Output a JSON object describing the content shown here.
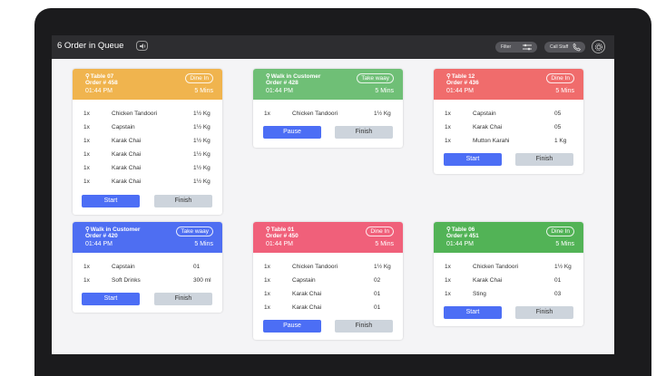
{
  "topbar": {
    "title": "6 Order in Queue",
    "filter_label": "Filter",
    "call_staff_label": "Call Staff"
  },
  "orders": [
    {
      "table": "Table 07",
      "order": "Order # 458",
      "time": "01:44 PM",
      "type": "Dine In",
      "duration": "5 Mins",
      "color": "#f0b44e",
      "items": [
        {
          "qty": "1x",
          "name": "Chicken Tandoori",
          "amount": "1½ Kg"
        },
        {
          "qty": "1x",
          "name": "Capstain",
          "amount": "1½ Kg"
        },
        {
          "qty": "1x",
          "name": "Karak Chai",
          "amount": "1½ Kg"
        },
        {
          "qty": "1x",
          "name": "Karak Chai",
          "amount": "1½ Kg"
        },
        {
          "qty": "1x",
          "name": "Karak Chai",
          "amount": "1½ Kg"
        },
        {
          "qty": "1x",
          "name": "Karak Chai",
          "amount": "1½ Kg"
        }
      ],
      "primary": "Start",
      "secondary": "Finish"
    },
    {
      "table": "Walk in Customer",
      "order": "Order # 428",
      "time": "01:44 PM",
      "type": "Take waay",
      "duration": "5 Mins",
      "color": "#6fbf76",
      "items": [
        {
          "qty": "1x",
          "name": "Chicken Tandoori",
          "amount": "1½ Kg"
        }
      ],
      "primary": "Pause",
      "secondary": "Finish"
    },
    {
      "table": "Table 12",
      "order": "Order # 436",
      "time": "01:44 PM",
      "type": "Dine In",
      "duration": "5 Mins",
      "color": "#f06c6c",
      "items": [
        {
          "qty": "1x",
          "name": "Capstain",
          "amount": "05"
        },
        {
          "qty": "1x",
          "name": "Karak Chai",
          "amount": "05"
        },
        {
          "qty": "1x",
          "name": "Mutton Karahi",
          "amount": "1 Kg"
        }
      ],
      "primary": "Start",
      "secondary": "Finish"
    },
    {
      "table": "Walk in Customer",
      "order": "Order # 420",
      "time": "01:44 PM",
      "type": "Take waay",
      "duration": "5 Mins",
      "color": "#4e6ef2",
      "items": [
        {
          "qty": "1x",
          "name": "Capstain",
          "amount": "01"
        },
        {
          "qty": "1x",
          "name": "Soft Drinks",
          "amount": "300 ml"
        }
      ],
      "primary": "Start",
      "secondary": "Finish"
    },
    {
      "table": "Table 01",
      "order": "Order # 450",
      "time": "01:44 PM",
      "type": "Dine In",
      "duration": "5 Mins",
      "color": "#f0607a",
      "items": [
        {
          "qty": "1x",
          "name": "Chicken Tandoori",
          "amount": "1½ Kg"
        },
        {
          "qty": "1x",
          "name": "Capstain",
          "amount": "02"
        },
        {
          "qty": "1x",
          "name": "Karak Chai",
          "amount": "01"
        },
        {
          "qty": "1x",
          "name": "Karak Chai",
          "amount": "01"
        }
      ],
      "primary": "Pause",
      "secondary": "Finish"
    },
    {
      "table": "Table 06",
      "order": "Order # 451",
      "time": "01:44 PM",
      "type": "Dine In",
      "duration": "5 Mins",
      "color": "#52b356",
      "items": [
        {
          "qty": "1x",
          "name": "Chicken Tandoori",
          "amount": "1½ Kg"
        },
        {
          "qty": "1x",
          "name": "Karak Chai",
          "amount": "01"
        },
        {
          "qty": "1x",
          "name": "Sting",
          "amount": "03"
        }
      ],
      "primary": "Start",
      "secondary": "Finish"
    }
  ]
}
